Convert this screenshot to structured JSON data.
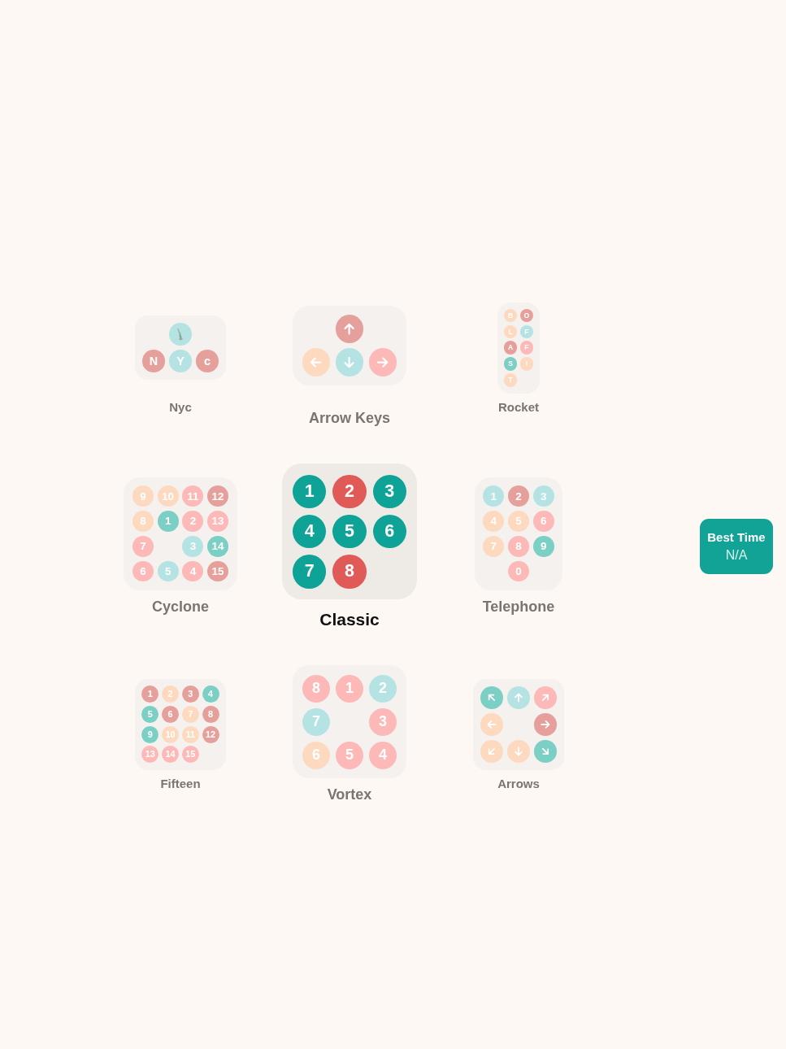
{
  "puzzles": [
    {
      "name": "Nyc",
      "selected": false,
      "rows": [
        [
          null,
          {
            "kind": "picture",
            "color": "#b5e3e3"
          },
          null
        ],
        [
          {
            "kind": "letter",
            "label": "N",
            "color": "#e6a09c"
          },
          {
            "kind": "letter",
            "label": "Y",
            "color": "#b5e3e3"
          },
          {
            "kind": "letter",
            "label": "c",
            "color": "#e6a09c"
          }
        ]
      ]
    },
    {
      "name": "Arrow Keys",
      "selected": false,
      "rows": [
        [
          null,
          {
            "kind": "up-arrow",
            "color": "#e6a09c"
          },
          null
        ],
        [
          {
            "kind": "left-arrow",
            "color": "#fdd9bf"
          },
          {
            "kind": "down-arrow",
            "color": "#b5e3e3"
          },
          {
            "kind": "right-arrow",
            "color": "#fcb9b7"
          }
        ]
      ]
    },
    {
      "name": "Rocket",
      "selected": false,
      "rows": [
        [
          {
            "kind": "letter",
            "label": "B",
            "color": "#fdd9bf"
          },
          {
            "kind": "letter",
            "label": "O",
            "color": "#e6a09c"
          }
        ],
        [
          {
            "kind": "letter",
            "label": "L",
            "color": "#fdd9bf"
          },
          {
            "kind": "letter",
            "label": "F",
            "color": "#b5e3e3"
          }
        ],
        [
          {
            "kind": "letter",
            "label": "A",
            "color": "#e6a09c"
          },
          {
            "kind": "letter",
            "label": "F",
            "color": "#fcb9b7"
          }
        ],
        [
          {
            "kind": "letter",
            "label": "S",
            "color": "#7ccfc4"
          },
          {
            "kind": "letter",
            "label": "!",
            "color": "#fdd9bf"
          }
        ],
        [
          {
            "kind": "letter",
            "label": "T",
            "color": "#fdd9bf"
          },
          null
        ]
      ]
    },
    {
      "name": "Cyclone",
      "selected": false,
      "rows": [
        [
          {
            "kind": "number",
            "label": "9",
            "color": "#fdd9bf"
          },
          {
            "kind": "number",
            "label": "10",
            "color": "#fdd9bf"
          },
          {
            "kind": "number",
            "label": "11",
            "color": "#fcb9b7"
          },
          {
            "kind": "number",
            "label": "12",
            "color": "#e6a09c"
          }
        ],
        [
          {
            "kind": "number",
            "label": "8",
            "color": "#fdd9bf"
          },
          {
            "kind": "number",
            "label": "1",
            "color": "#7ccfc4"
          },
          {
            "kind": "number",
            "label": "2",
            "color": "#fcb9b7"
          },
          {
            "kind": "number",
            "label": "13",
            "color": "#fcb9b7"
          }
        ],
        [
          {
            "kind": "number",
            "label": "7",
            "color": "#fcb9b7"
          },
          null,
          {
            "kind": "number",
            "label": "3",
            "color": "#b5e3e3"
          },
          {
            "kind": "number",
            "label": "14",
            "color": "#7ccfc4"
          }
        ],
        [
          {
            "kind": "number",
            "label": "6",
            "color": "#fcb9b7"
          },
          {
            "kind": "number",
            "label": "5",
            "color": "#b5e3e3"
          },
          {
            "kind": "number",
            "label": "4",
            "color": "#fcb9b7"
          },
          {
            "kind": "number",
            "label": "15",
            "color": "#e6a09c"
          }
        ]
      ]
    },
    {
      "name": "Classic",
      "selected": true,
      "rows": [
        [
          {
            "kind": "number",
            "label": "1",
            "color": "#0ea396"
          },
          {
            "kind": "number",
            "label": "2",
            "color": "#e05b57"
          },
          {
            "kind": "number",
            "label": "3",
            "color": "#0ea396"
          }
        ],
        [
          {
            "kind": "number",
            "label": "4",
            "color": "#0ea396"
          },
          {
            "kind": "number",
            "label": "5",
            "color": "#0ea396"
          },
          {
            "kind": "number",
            "label": "6",
            "color": "#0ea396"
          }
        ],
        [
          {
            "kind": "number",
            "label": "7",
            "color": "#0ea396"
          },
          {
            "kind": "number",
            "label": "8",
            "color": "#e05b57"
          },
          null
        ]
      ]
    },
    {
      "name": "Telephone",
      "selected": false,
      "rows": [
        [
          {
            "kind": "number",
            "label": "1",
            "color": "#b5e3e3"
          },
          {
            "kind": "number",
            "label": "2",
            "color": "#e6a09c"
          },
          {
            "kind": "number",
            "label": "3",
            "color": "#b5e3e3"
          }
        ],
        [
          {
            "kind": "number",
            "label": "4",
            "color": "#fdd9bf"
          },
          {
            "kind": "number",
            "label": "5",
            "color": "#fdd9bf"
          },
          {
            "kind": "number",
            "label": "6",
            "color": "#fcb9b7"
          }
        ],
        [
          {
            "kind": "number",
            "label": "7",
            "color": "#fdd9bf"
          },
          {
            "kind": "number",
            "label": "8",
            "color": "#fcb9b7"
          },
          {
            "kind": "number",
            "label": "9",
            "color": "#7ccfc4"
          }
        ],
        [
          null,
          {
            "kind": "number",
            "label": "0",
            "color": "#fcb9b7"
          },
          null
        ]
      ]
    },
    {
      "name": "Fifteen",
      "selected": false,
      "rows": [
        [
          {
            "kind": "number",
            "label": "1",
            "color": "#e6a09c"
          },
          {
            "kind": "number",
            "label": "2",
            "color": "#fdd9bf"
          },
          {
            "kind": "number",
            "label": "3",
            "color": "#e6a09c"
          },
          {
            "kind": "number",
            "label": "4",
            "color": "#7ccfc4"
          }
        ],
        [
          {
            "kind": "number",
            "label": "5",
            "color": "#7ccfc4"
          },
          {
            "kind": "number",
            "label": "6",
            "color": "#e6a09c"
          },
          {
            "kind": "number",
            "label": "7",
            "color": "#fdd9bf"
          },
          {
            "kind": "number",
            "label": "8",
            "color": "#e6a09c"
          }
        ],
        [
          {
            "kind": "number",
            "label": "9",
            "color": "#7ccfc4"
          },
          {
            "kind": "number",
            "label": "10",
            "color": "#fdd9bf"
          },
          {
            "kind": "number",
            "label": "11",
            "color": "#fdd9bf"
          },
          {
            "kind": "number",
            "label": "12",
            "color": "#e6a09c"
          }
        ],
        [
          {
            "kind": "number",
            "label": "13",
            "color": "#fcb9b7"
          },
          {
            "kind": "number",
            "label": "14",
            "color": "#fcb9b7"
          },
          {
            "kind": "number",
            "label": "15",
            "color": "#fcb9b7"
          },
          null
        ]
      ]
    },
    {
      "name": "Vortex",
      "selected": false,
      "rows": [
        [
          {
            "kind": "number",
            "label": "8",
            "color": "#fcb9b7"
          },
          {
            "kind": "number",
            "label": "1",
            "color": "#fcb9b7"
          },
          {
            "kind": "number",
            "label": "2",
            "color": "#b5e3e3"
          }
        ],
        [
          {
            "kind": "number",
            "label": "7",
            "color": "#b5e3e3"
          },
          null,
          {
            "kind": "number",
            "label": "3",
            "color": "#fcb9b7"
          }
        ],
        [
          {
            "kind": "number",
            "label": "6",
            "color": "#fdd9bf"
          },
          {
            "kind": "number",
            "label": "5",
            "color": "#fcb9b7"
          },
          {
            "kind": "number",
            "label": "4",
            "color": "#fcb9b7"
          }
        ]
      ]
    },
    {
      "name": "Arrows",
      "selected": false,
      "rows": [
        [
          {
            "kind": "up-left-arrow",
            "color": "#7ccfc4"
          },
          {
            "kind": "up-arrow",
            "color": "#b5e3e3"
          },
          {
            "kind": "up-right-arrow",
            "color": "#fcb9b7"
          }
        ],
        [
          {
            "kind": "left-arrow",
            "color": "#fdd9bf"
          },
          null,
          {
            "kind": "right-arrow",
            "color": "#e6a09c"
          }
        ],
        [
          {
            "kind": "down-left-arrow",
            "color": "#fdd9bf"
          },
          {
            "kind": "down-arrow",
            "color": "#fdd9bf"
          },
          {
            "kind": "down-right-arrow",
            "color": "#7ccfc4"
          }
        ]
      ]
    }
  ],
  "best_time": {
    "title": "Best Time",
    "value": "N/A"
  }
}
